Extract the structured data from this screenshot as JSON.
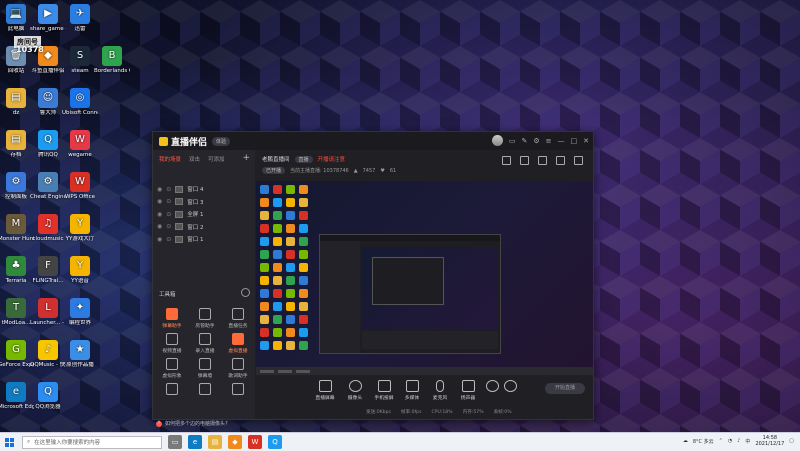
{
  "desktop": {
    "room_label": "房间号",
    "room_number": "10378",
    "icons": [
      {
        "label": "此电脑",
        "color": "#2e7bd6",
        "glyph": "💻",
        "name": "this-pc-icon"
      },
      {
        "label": "share_game - 快捷方式",
        "color": "#3d8be8",
        "glyph": "▶",
        "name": "share-game-icon"
      },
      {
        "label": "迅雷",
        "color": "#2a7de1",
        "glyph": "✈",
        "name": "xunlei-icon"
      },
      {
        "label": "回收站",
        "color": "#6d8fb0",
        "glyph": "🗑",
        "name": "recycle-bin-icon"
      },
      {
        "label": "斗鱼直播伴侣",
        "color": "#f08a1c",
        "glyph": "◆",
        "name": "douyu-icon"
      },
      {
        "label": "steam",
        "color": "#1b2838",
        "glyph": "S",
        "name": "steam-icon"
      },
      {
        "label": "Borderlands CN Chat",
        "color": "#2ea44f",
        "glyph": "B",
        "name": "borderlands-icon"
      },
      {
        "label": "dz",
        "color": "#e8b33c",
        "glyph": "▤",
        "name": "folder-icon"
      },
      {
        "label": "鲁大师",
        "color": "#3a7bd5",
        "glyph": "☺",
        "name": "ludashi-icon"
      },
      {
        "label": "Ubisoft Connect",
        "color": "#1a73e8",
        "glyph": "◎",
        "name": "ubisoft-icon"
      },
      {
        "label": "存档",
        "color": "#e8b33c",
        "glyph": "▤",
        "name": "folder-icon"
      },
      {
        "label": "腾讯QQ",
        "color": "#1d9bf0",
        "glyph": "Q",
        "name": "qq-icon"
      },
      {
        "label": "wegame",
        "color": "#e63946",
        "glyph": "W",
        "name": "wegame-icon"
      },
      {
        "label": "控制面板",
        "color": "#3c78d8",
        "glyph": "⚙",
        "name": "control-panel-icon"
      },
      {
        "label": "Cheat Engine",
        "color": "#4a7fb5",
        "glyph": "⚙",
        "name": "cheat-engine-icon"
      },
      {
        "label": "WPS Office",
        "color": "#d93025",
        "glyph": "W",
        "name": "wps-icon"
      },
      {
        "label": "Monster Hunter...",
        "color": "#6a5a3a",
        "glyph": "M",
        "name": "monster-hunter-icon"
      },
      {
        "label": "cloudmusic",
        "color": "#e0312b",
        "glyph": "♫",
        "name": "cloudmusic-icon"
      },
      {
        "label": "YY游戏大厅",
        "color": "#f4b400",
        "glyph": "Y",
        "name": "yy-game-icon"
      },
      {
        "label": "Terraria",
        "color": "#2f8a3b",
        "glyph": "♣",
        "name": "terraria-icon"
      },
      {
        "label": "FLiNGTrai...",
        "color": "#444",
        "glyph": "F",
        "name": "fling-icon"
      },
      {
        "label": "YY语音",
        "color": "#f4b400",
        "glyph": "Y",
        "name": "yy-voice-icon"
      },
      {
        "label": "tModLoa...",
        "color": "#3a6a3a",
        "glyph": "T",
        "name": "tmodloader-icon"
      },
      {
        "label": "Launcher... - 快捷方式",
        "color": "#d03030",
        "glyph": "L",
        "name": "launcher-icon"
      },
      {
        "label": "编程世界",
        "color": "#2d7be0",
        "glyph": "✦",
        "name": "program-icon"
      },
      {
        "label": "GeForce Experience",
        "color": "#76b900",
        "glyph": "G",
        "name": "geforce-icon"
      },
      {
        "label": "QQMusic - 快捷方式",
        "color": "#f7c600",
        "glyph": "♪",
        "name": "qqmusic-icon"
      },
      {
        "label": "原创作品播",
        "color": "#3a8ee6",
        "glyph": "★",
        "name": "yuanchuang-icon"
      },
      {
        "label": "Microsoft Edge",
        "color": "#0f7bc1",
        "glyph": "e",
        "name": "edge-icon"
      },
      {
        "label": "QQ浏览器",
        "color": "#2d8cf0",
        "glyph": "Q",
        "name": "qq-browser-icon"
      }
    ]
  },
  "app": {
    "title": "直播伴侣",
    "version": "体验",
    "tabs": [
      "我的场景",
      "双击",
      "可添加"
    ],
    "sources": [
      "窗口 4",
      "窗口 3",
      "全屏 1",
      "窗口 2",
      "窗口 1"
    ],
    "toolbox_title": "工具箱",
    "tools": [
      {
        "label": "弹幕助手",
        "hot": true
      },
      {
        "label": "房管助手",
        "hot": false
      },
      {
        "label": "直播任务",
        "hot": false
      },
      {
        "label": "视频直播",
        "hot": false
      },
      {
        "label": "录入直播",
        "hot": false
      },
      {
        "label": "虚拟直播",
        "hot": true
      },
      {
        "label": "虚拟形象",
        "hot": false
      },
      {
        "label": "弹幕墙",
        "hot": false
      },
      {
        "label": "歌词助手",
        "hot": false
      },
      {
        "label": "",
        "hot": false
      },
      {
        "label": "",
        "hot": false
      },
      {
        "label": "",
        "hot": false
      }
    ],
    "tip_text": "如何把多个边的电脑摄像头?",
    "room": {
      "name": "老鹏直播间",
      "status_pill": "直播",
      "red_text": "开播请注意",
      "category": "已开播",
      "sub_text": "当前主播直播: 10378746",
      "viewers": "7457",
      "likes": "61"
    },
    "bottom_tools": [
      "直播屏幕",
      "摄像头",
      "手机投屏",
      "多媒体",
      "麦克风",
      "扬声器"
    ],
    "start_button": "开始直播",
    "status_items": [
      "发送:0Kbps",
      "帧率:0fps",
      "CPU:18%",
      "内存:57%",
      "丢帧:0%"
    ]
  },
  "taskbar": {
    "search_placeholder": "在这里输入你要搜索的内容",
    "weather": "8°C 多云",
    "time": "14:58",
    "date": "2021/12/17"
  }
}
